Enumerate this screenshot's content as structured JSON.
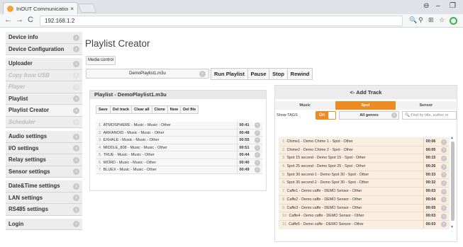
{
  "browser": {
    "tab_title": "InOUT Communication S",
    "tab_close": "×",
    "url": "192.168.1.2",
    "back": "←",
    "forward": "→",
    "reload": "C",
    "ctl_account": "⊖",
    "ctl_minimize": "–",
    "ctl_restore": "❐",
    "ext_search": "🔍",
    "ext_key": "⚲",
    "ext_bookmark": "☆",
    "ext_media": "⊞"
  },
  "sidebar": {
    "groups": [
      [
        {
          "label": "Device info",
          "disabled": false
        },
        {
          "label": "Device Configuration",
          "disabled": false
        }
      ],
      [
        {
          "label": "Uploader",
          "disabled": false
        },
        {
          "label": "Copy from USB",
          "disabled": true
        },
        {
          "label": "Player",
          "disabled": true
        },
        {
          "label": "Playlist",
          "disabled": false
        },
        {
          "label": "Playlist Creator",
          "disabled": false,
          "active": true
        },
        {
          "label": "Scheduler",
          "disabled": true
        }
      ],
      [
        {
          "label": "Audio settings",
          "disabled": false
        },
        {
          "label": "I/O settings",
          "disabled": false
        },
        {
          "label": "Relay settings",
          "disabled": false
        },
        {
          "label": "Sensor settings",
          "disabled": false
        }
      ],
      [
        {
          "label": "Date&Time settings",
          "disabled": false
        },
        {
          "label": "LAN settings",
          "disabled": false
        },
        {
          "label": "RS485 settings",
          "disabled": false
        }
      ],
      [
        {
          "label": "Login",
          "disabled": false
        }
      ]
    ]
  },
  "main": {
    "title": "Playlist Creator",
    "media_control": "Media control",
    "playlist_file": "DemoPlaylist1.m3u",
    "controls": [
      "Run Playlist",
      "Pause",
      "Stop",
      "Rewind"
    ]
  },
  "playlist_panel": {
    "title": "Playlist - DemoPlaylist1.m3u",
    "toolbar": [
      "Save",
      "Del track",
      "Clear all",
      "Clone",
      "New",
      "Del file"
    ],
    "tracks": [
      {
        "num": "1.",
        "name": "ATMOSPHERE - Music - Music - Other",
        "dur": "00:41"
      },
      {
        "num": "2.",
        "name": "ARKANOID - Music - Music - Other",
        "dur": "00:48"
      },
      {
        "num": "3.",
        "name": "EXHALE - Music - Music - Other",
        "dur": "00:55"
      },
      {
        "num": "4.",
        "name": "MIDDLE_808 - Music - Music - Other",
        "dur": "00:51"
      },
      {
        "num": "5.",
        "name": "TRUE - Music - Music - Other",
        "dur": "00:44"
      },
      {
        "num": "6.",
        "name": "WORD - Music - Music - Other",
        "dur": "00:40"
      },
      {
        "num": "7.",
        "name": "BLUEX - Music - Music - Other",
        "dur": "00:49"
      }
    ]
  },
  "add_panel": {
    "title": "<- Add Track",
    "tabs": [
      {
        "label": "Music",
        "active": false
      },
      {
        "label": "Spot",
        "active": true
      },
      {
        "label": "Sensor",
        "active": false
      }
    ],
    "show_tags": "Show TAGS",
    "toggle": "On",
    "genre": "All genres",
    "search_placeholder": "🔍 Find by title, author or",
    "tracks": [
      {
        "num": "1.",
        "name": "Chime1 - Demo Chime 1 - Spot - Other",
        "dur": "00:06"
      },
      {
        "num": "2.",
        "name": "Chime2 - Demo Chime 2 - Spot - Other",
        "dur": "00:05"
      },
      {
        "num": "3.",
        "name": "Spot 15 second - Demo Spot 15 - Spot - Other",
        "dur": "00:15"
      },
      {
        "num": "4.",
        "name": "Spot 25 second - Demo Spot 25 - Spot - Other",
        "dur": "00:26"
      },
      {
        "num": "5.",
        "name": "Spot 30 second-1 - Demo Spot 30 - Spot - Other",
        "dur": "00:33"
      },
      {
        "num": "6.",
        "name": "Spot 30 second-2 - Demo Spot 30 - Spot - Other",
        "dur": "00:32"
      },
      {
        "num": "7.",
        "name": "Caffe1 - Demo caffe - DEMO Sensor - Other",
        "dur": "00:03"
      },
      {
        "num": "8.",
        "name": "Caffe2 - Demo caffe - DEMO Sensor - Other",
        "dur": "00:04"
      },
      {
        "num": "9.",
        "name": "Caffe3 - Demo caffe - DEMO Sensor - Other",
        "dur": "00:05"
      },
      {
        "num": "10.",
        "name": "Caffe4 - Demo caffe - DEMO Sensor - Other",
        "dur": "00:03"
      },
      {
        "num": "11.",
        "name": "Caffe5 - Demo caffe - DEMO Sensor - Other",
        "dur": "00:03"
      }
    ]
  },
  "colors": {
    "accent": "#ef8a1e",
    "spot_row": "#fbeee0",
    "favicon": "#f2a33a"
  }
}
